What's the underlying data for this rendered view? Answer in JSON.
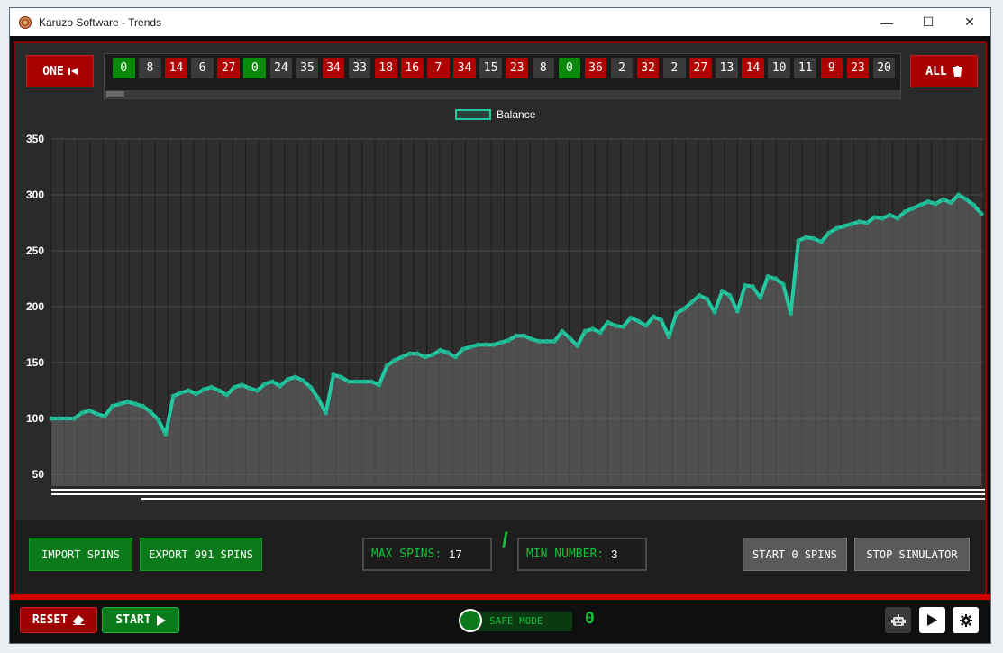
{
  "window": {
    "title": "Karuzo Software - Trends",
    "controls": {
      "minimize": "—",
      "maximize": "☐",
      "close": "✕"
    }
  },
  "toolbar": {
    "one_label": "ONE",
    "one_icon": "skip-back-icon",
    "all_label": "ALL",
    "all_icon": "trash-icon"
  },
  "spins": [
    {
      "n": "0",
      "c": "green"
    },
    {
      "n": "8",
      "c": "black"
    },
    {
      "n": "14",
      "c": "red"
    },
    {
      "n": "6",
      "c": "black"
    },
    {
      "n": "27",
      "c": "red"
    },
    {
      "n": "0",
      "c": "green"
    },
    {
      "n": "24",
      "c": "black"
    },
    {
      "n": "35",
      "c": "black"
    },
    {
      "n": "34",
      "c": "red"
    },
    {
      "n": "33",
      "c": "black"
    },
    {
      "n": "18",
      "c": "red"
    },
    {
      "n": "16",
      "c": "red"
    },
    {
      "n": "7",
      "c": "red"
    },
    {
      "n": "34",
      "c": "red"
    },
    {
      "n": "15",
      "c": "black"
    },
    {
      "n": "23",
      "c": "red"
    },
    {
      "n": "8",
      "c": "black"
    },
    {
      "n": "0",
      "c": "green"
    },
    {
      "n": "36",
      "c": "red"
    },
    {
      "n": "2",
      "c": "black"
    },
    {
      "n": "32",
      "c": "red"
    },
    {
      "n": "2",
      "c": "black"
    },
    {
      "n": "27",
      "c": "red"
    },
    {
      "n": "13",
      "c": "black"
    },
    {
      "n": "14",
      "c": "red"
    },
    {
      "n": "10",
      "c": "black"
    },
    {
      "n": "11",
      "c": "black"
    },
    {
      "n": "9",
      "c": "red"
    },
    {
      "n": "23",
      "c": "red"
    },
    {
      "n": "20",
      "c": "black"
    }
  ],
  "colors": {
    "red": "#b00000",
    "black": "#3a3a3a",
    "green": "#0a8a0a",
    "line": "#22c8a0"
  },
  "chart_data": {
    "type": "line",
    "series": [
      {
        "name": "Balance",
        "values": [
          100,
          100,
          100,
          100,
          105,
          107,
          104,
          102,
          111,
          113,
          115,
          113,
          111,
          106,
          99,
          86,
          120,
          123,
          125,
          122,
          126,
          128,
          125,
          121,
          128,
          130,
          127,
          125,
          131,
          133,
          129,
          135,
          137,
          134,
          128,
          118,
          105,
          139,
          137,
          133,
          133,
          133,
          133,
          130,
          147,
          152,
          155,
          158,
          158,
          155,
          157,
          161,
          159,
          155,
          162,
          164,
          166,
          166,
          166,
          168,
          170,
          174,
          174,
          171,
          169,
          169,
          169,
          178,
          172,
          165,
          178,
          180,
          177,
          186,
          183,
          182,
          190,
          187,
          183,
          191,
          188,
          173,
          194,
          198,
          204,
          210,
          207,
          195,
          214,
          210,
          196,
          219,
          218,
          208,
          227,
          225,
          220,
          194,
          259,
          262,
          261,
          258,
          266,
          270,
          272,
          274,
          276,
          275,
          280,
          279,
          282,
          279,
          285,
          288,
          291,
          294,
          292,
          296,
          293,
          300,
          296,
          291,
          283
        ]
      }
    ],
    "ylim": [
      50,
      350
    ],
    "yticks": [
      "350",
      "300",
      "250",
      "200",
      "150",
      "100",
      "50"
    ],
    "grid": true,
    "legend": "top-center"
  },
  "bottom": {
    "import_label": "IMPORT SPINS",
    "export_label": "EXPORT 991 SPINS",
    "max_spins_label": "MAX SPINS:",
    "max_spins_value": "17",
    "slash": "/",
    "min_number_label": "MIN NUMBER:",
    "min_number_value": "3",
    "start_spins_label": "START 0 SPINS",
    "stop_label": "STOP SIMULATOR"
  },
  "footer": {
    "reset_label": "RESET",
    "reset_icon": "eraser-icon",
    "start_label": "START",
    "start_icon": "play-icon",
    "safe_mode_label": "SAFE MODE",
    "safe_mode_count": "0",
    "robot_icon": "robot-icon",
    "play_icon": "play-icon",
    "settings_icon": "gear-icon"
  }
}
